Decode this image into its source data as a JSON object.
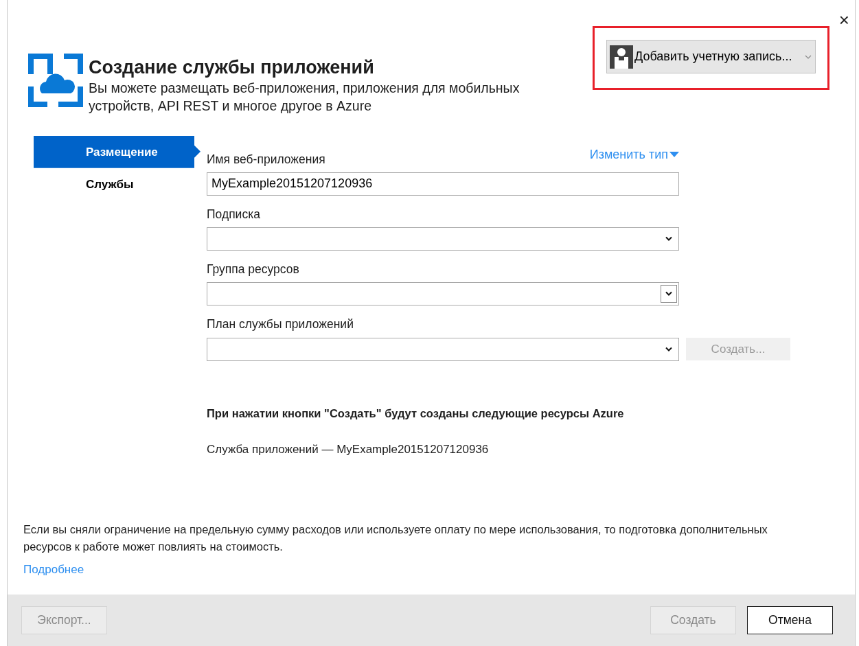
{
  "window": {
    "close": "×"
  },
  "header": {
    "title": "Создание службы приложений",
    "subtitle": "Вы можете размещать веб-приложения, приложения для мобильных устройств, API REST и многое другое в Azure",
    "account_button": "Добавить учетную запись..."
  },
  "sidebar": {
    "items": [
      {
        "label": "Размещение",
        "selected": true
      },
      {
        "label": "Службы",
        "selected": false
      }
    ]
  },
  "form": {
    "change_type_link": "Изменить тип",
    "fields": [
      {
        "label": "Имя веб-приложения",
        "kind": "text",
        "value": "MyExample20151207120936"
      },
      {
        "label": "Подписка",
        "kind": "select",
        "hovered": false
      },
      {
        "label": "Группа ресурсов",
        "kind": "select",
        "hovered": true
      },
      {
        "label": "План службы приложений",
        "kind": "select",
        "hovered": false,
        "side_button": {
          "label": "Создать...",
          "disabled": true
        }
      }
    ]
  },
  "summary": {
    "heading": "При нажатии кнопки \"Создать\" будут созданы следующие ресурсы Azure",
    "items": [
      "Служба приложений — MyExample20151207120936"
    ]
  },
  "note": {
    "text": "Если вы сняли ограничение на предельную сумму расходов или используете оплату по мере использования, то подготовка дополнительных ресурсов к работе может повлиять на стоимость.",
    "link": "Подробнее"
  },
  "footer": {
    "left_buttons": [
      {
        "label": "Экспорт...",
        "disabled": true
      }
    ],
    "right_buttons": [
      {
        "label": "Создать",
        "disabled": true
      },
      {
        "label": "Отмена",
        "disabled": false
      }
    ]
  }
}
